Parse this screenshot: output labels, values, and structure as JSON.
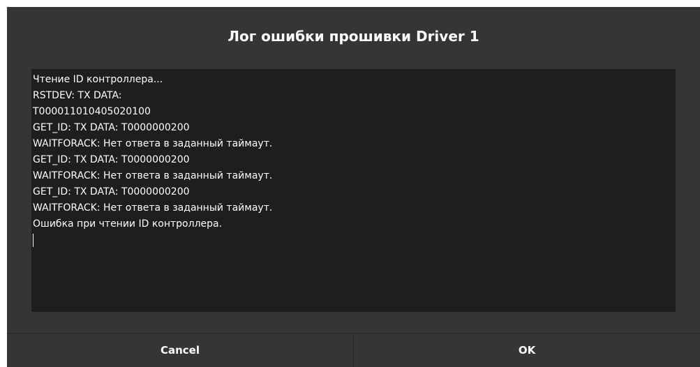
{
  "dialog": {
    "title": "Лог ошибки прошивки Driver 1",
    "log_lines": [
      "Чтение ID контроллера...",
      "RSTDEV: TX DATA:",
      "T000011010405020100",
      "GET_ID: TX DATA: T0000000200",
      "WAITFORACK: Нет ответа в заданный таймаут.",
      "GET_ID: TX DATA: T0000000200",
      "WAITFORACK: Нет ответа в заданный таймаут.",
      "GET_ID: TX DATA: T0000000200",
      "WAITFORACK: Нет ответа в заданный таймаут.",
      "Ошибка при чтении ID контроллера."
    ],
    "buttons": {
      "cancel_label": "Cancel",
      "ok_label": "OK"
    }
  },
  "colors": {
    "dialog_bg": "#353535",
    "log_bg": "#1e1e1e",
    "text": "#ffffff"
  }
}
